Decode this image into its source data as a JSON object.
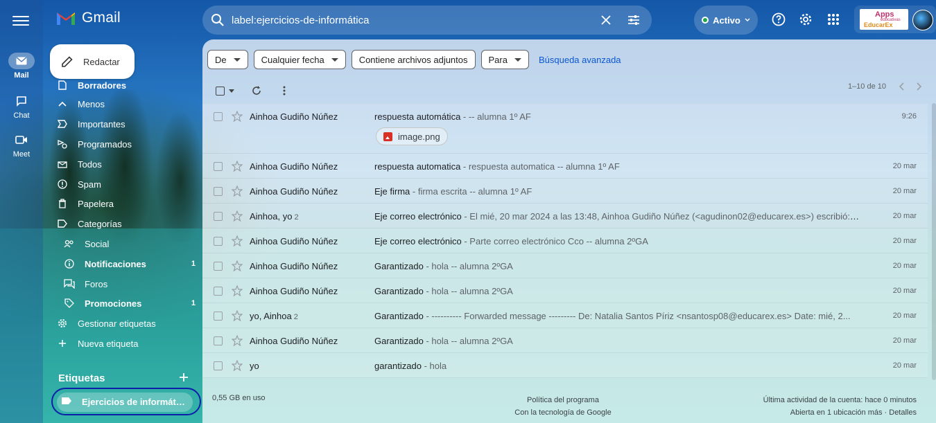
{
  "rail": {
    "mail": "Mail",
    "chat": "Chat",
    "meet": "Meet"
  },
  "logo": {
    "text": "Gmail"
  },
  "search": {
    "value": "label:ejercicios-de-informática"
  },
  "status": {
    "label": "Activo"
  },
  "brand": {
    "line1": "Apps",
    "line2": "educativas",
    "line3": "EducarEx"
  },
  "compose": {
    "label": "Redactar"
  },
  "nav": {
    "items": [
      {
        "label": "Borradores",
        "icon": "file-icon"
      },
      {
        "label": "Menos",
        "icon": "chevron-up-icon"
      },
      {
        "label": "Importantes",
        "icon": "label-important-icon"
      },
      {
        "label": "Programados",
        "icon": "schedule-send-icon"
      },
      {
        "label": "Todos",
        "icon": "all-mail-icon"
      },
      {
        "label": "Spam",
        "icon": "spam-icon"
      },
      {
        "label": "Papelera",
        "icon": "trash-icon"
      },
      {
        "label": "Categorías",
        "icon": "label-icon"
      },
      {
        "label": "Social",
        "icon": "people-icon"
      },
      {
        "label": "Notificaciones",
        "icon": "info-icon",
        "count": "1"
      },
      {
        "label": "Foros",
        "icon": "forum-icon"
      },
      {
        "label": "Promociones",
        "icon": "tag-icon",
        "count": "1"
      },
      {
        "label": "Gestionar etiquetas",
        "icon": "gear-icon"
      },
      {
        "label": "Nueva etiqueta",
        "icon": "plus-icon"
      }
    ]
  },
  "labels": {
    "title": "Etiquetas",
    "active": "Ejercicios de informática"
  },
  "filters": {
    "from": "De",
    "date": "Cualquier fecha",
    "attachments": "Contiene archivos adjuntos",
    "to": "Para",
    "advanced": "Búsqueda avanzada"
  },
  "pager": {
    "range": "1–10 de 10"
  },
  "emails": [
    {
      "from": "Ainhoa Gudiño Núñez",
      "count": "",
      "subject": "respuesta automática",
      "snippet": " - -- alumna 1º AF",
      "date": "9:26",
      "attachment": "image.png"
    },
    {
      "from": "Ainhoa Gudiño Núñez",
      "count": "",
      "subject": "respuesta automatica",
      "snippet": " - respuesta automatica -- alumna 1º AF",
      "date": "20 mar"
    },
    {
      "from": "Ainhoa Gudiño Núñez",
      "count": "",
      "subject": "Eje firma",
      "snippet": " - firma escrita -- alumna 1º AF",
      "date": "20 mar"
    },
    {
      "from": "Ainhoa, yo",
      "count": "2",
      "subject": "Eje correo electrónico",
      "snippet": " - El mié, 20 mar 2024 a las 13:48, Ainhoa Gudiño Núñez (<agudinon02@educarex.es>) escribió: Pa...",
      "date": "20 mar"
    },
    {
      "from": "Ainhoa Gudiño Núñez",
      "count": "",
      "subject": "Eje correo electrónico",
      "snippet": " - Parte correo electrónico Cco -- alumna 2ºGA",
      "date": "20 mar"
    },
    {
      "from": "Ainhoa Gudiño Núñez",
      "count": "",
      "subject": "Garantizado",
      "snippet": " - hola -- alumna 2ºGA",
      "date": "20 mar"
    },
    {
      "from": "Ainhoa Gudiño Núñez",
      "count": "",
      "subject": "Garantizado",
      "snippet": " - hola -- alumna 2ºGA",
      "date": "20 mar"
    },
    {
      "from": "yo, Ainhoa",
      "count": "2",
      "subject": "Garantizado",
      "snippet": " - ---------- Forwarded message --------- De: Natalia Santos Píriz <nsantosp08@educarex.es> Date: mié, 2...",
      "date": "20 mar"
    },
    {
      "from": "Ainhoa Gudiño Núñez",
      "count": "",
      "subject": "Garantizado",
      "snippet": " - hola -- alumna 2ºGA",
      "date": "20 mar"
    },
    {
      "from": "yo",
      "count": "",
      "subject": "garantizado",
      "snippet": " - hola",
      "date": "20 mar"
    }
  ],
  "footer": {
    "storage": "0,55 GB en uso",
    "policy": "Política del programa",
    "powered": "Con la tecnología de Google",
    "activity": "Última actividad de la cuenta: hace 0 minutos",
    "location": "Abierta en 1 ubicación más · Detalles"
  },
  "colors": {
    "accent": "#0b57d0",
    "circle_annotation": "#0b1fa8",
    "status_dot": "#1fa84a"
  }
}
